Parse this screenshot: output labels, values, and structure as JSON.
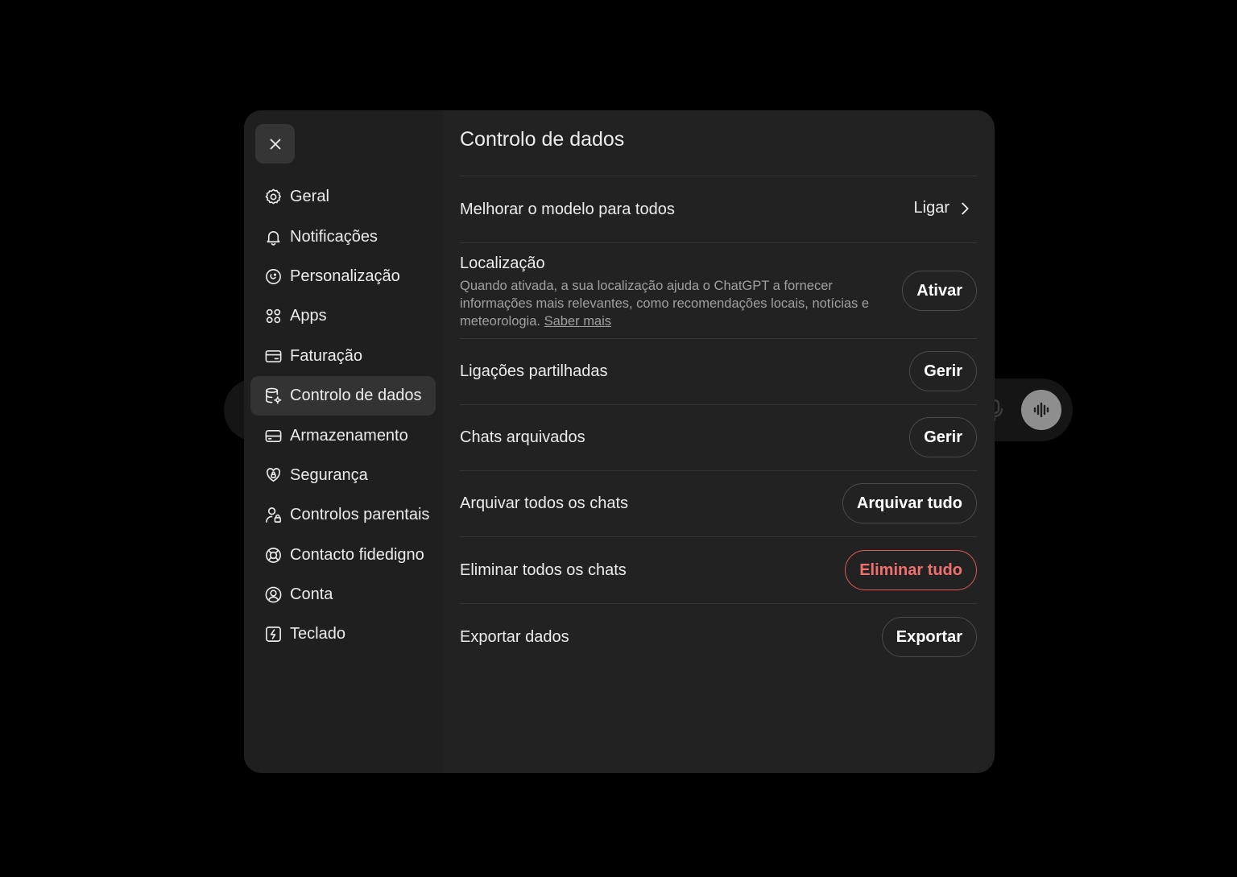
{
  "sidebar": {
    "close_label": "Fechar",
    "items": [
      {
        "label": "Geral",
        "icon": "gear-icon"
      },
      {
        "label": "Notificações",
        "icon": "bell-icon"
      },
      {
        "label": "Personalização",
        "icon": "personalization-icon"
      },
      {
        "label": "Apps",
        "icon": "apps-grid-icon"
      },
      {
        "label": "Faturação",
        "icon": "credit-card-icon"
      },
      {
        "label": "Controlo de dados",
        "icon": "database-gear-icon",
        "active": true
      },
      {
        "label": "Armazenamento",
        "icon": "storage-drive-icon"
      },
      {
        "label": "Segurança",
        "icon": "shield-lock-icon"
      },
      {
        "label": "Controlos parentais",
        "icon": "person-lock-icon"
      },
      {
        "label": "Contacto fidedigno",
        "icon": "lifebuoy-icon"
      },
      {
        "label": "Conta",
        "icon": "user-circle-icon"
      },
      {
        "label": "Teclado",
        "icon": "keyboard-shortcut-icon"
      }
    ]
  },
  "main": {
    "title": "Controlo de dados",
    "improve_model": {
      "label": "Melhorar o modelo para todos",
      "value": "Ligar"
    },
    "location": {
      "label": "Localização",
      "description": "Quando ativada, a sua localização ajuda o ChatGPT a fornecer informações mais relevantes, como recomendações locais, notícias e meteorologia.",
      "learn_more": "Saber mais",
      "button": "Ativar"
    },
    "shared_links": {
      "label": "Ligações partilhadas",
      "button": "Gerir"
    },
    "archived_chats": {
      "label": "Chats arquivados",
      "button": "Gerir"
    },
    "archive_all": {
      "label": "Arquivar todos os chats",
      "button": "Arquivar tudo"
    },
    "delete_all": {
      "label": "Eliminar todos os chats",
      "button": "Eliminar tudo"
    },
    "export": {
      "label": "Exportar dados",
      "button": "Exportar"
    }
  },
  "colors": {
    "background": "#000000",
    "modal": "#222222",
    "active_item": "#333333",
    "danger": "#e25b5b"
  }
}
